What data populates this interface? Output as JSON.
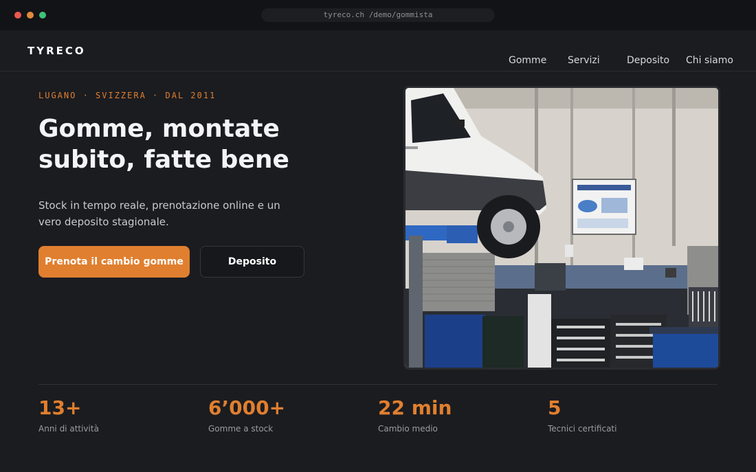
{
  "browser": {
    "url": "tyreco.ch /demo/gommista",
    "window_controls": [
      "close",
      "minimize",
      "maximize"
    ]
  },
  "header": {
    "logo": "TYRECO",
    "nav": [
      "Gomme",
      "Servizi",
      "Deposito",
      "Chi siamo"
    ]
  },
  "hero": {
    "eyebrow": "LUGANO · SVIZZERA · DAL 2011",
    "headline": "Gomme, montate subito, fatte bene",
    "lead": "Stock in tempo reale, prenotazione online e un vero deposito stagionale.",
    "primary_cta": "Prenota il cambio gomme",
    "secondary_cta": "Deposito",
    "image_desc_icon": "garage-photo-icon"
  },
  "stats": [
    {
      "value": "13+",
      "label": "Anni di attività"
    },
    {
      "value": "6’000+",
      "label": "Gomme a stock"
    },
    {
      "value": "22 min",
      "label": "Cambio medio"
    },
    {
      "value": "5",
      "label": "Tecnici certificati"
    }
  ],
  "colors": {
    "accent": "#e07f2f",
    "background": "#1b1c20",
    "chrome": "#121316"
  }
}
